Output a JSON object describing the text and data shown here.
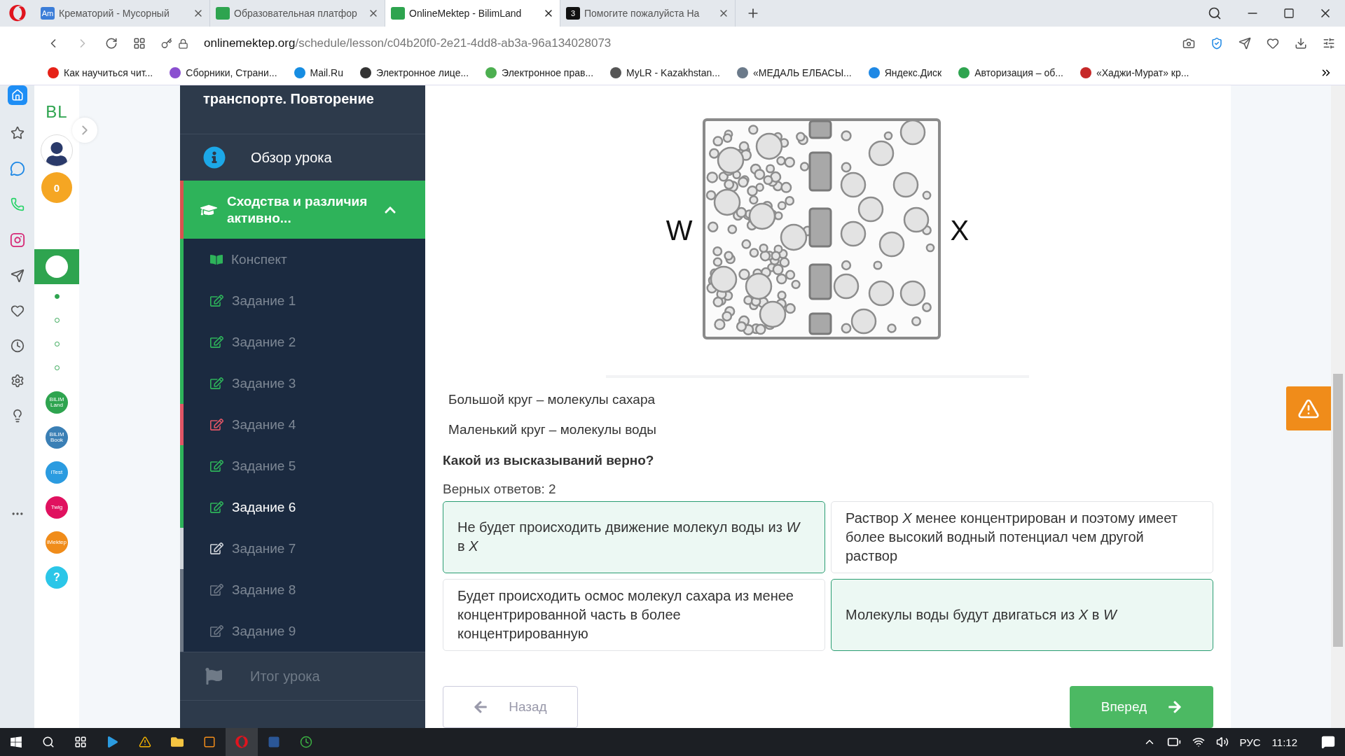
{
  "browser": {
    "tabs": [
      {
        "icon_text": "Am",
        "title": "Крематорий - Мусорный",
        "selected": false
      },
      {
        "title": "Образовательная платфор",
        "selected": false
      },
      {
        "title": "OnlineMektep - BilimLand",
        "selected": true
      },
      {
        "icon_text": "3",
        "title": "Помогите пожалуйста На",
        "selected": false
      }
    ],
    "url_host": "onlinemektep.org",
    "url_path": "/schedule/lesson/c04b20f0-2e21-4dd8-ab3a-96a134028073",
    "bookmarks": [
      {
        "title": "Как научиться чит...",
        "color": "#e62117"
      },
      {
        "title": "Сборники, Страни...",
        "color": "#8a4fd0"
      },
      {
        "title": "Mail.Ru",
        "color": "#168de2"
      },
      {
        "title": "Электронное лице...",
        "color": "#333333"
      },
      {
        "title": "Электронное прав...",
        "color": "#4caf50"
      },
      {
        "title": "MyLR - Kazakhstan...",
        "color": "#555555"
      },
      {
        "title": "«МЕДАЛЬ ЕЛБАСЫ...",
        "color": "#6b7a8a"
      },
      {
        "title": "Яндекс.Диск",
        "color": "#1e88e5"
      },
      {
        "title": "Авторизация – об...",
        "color": "#2ea44f"
      },
      {
        "title": "«Хаджи-Мурат» кр...",
        "color": "#c62828"
      }
    ]
  },
  "app_rail": {
    "logo": "BL",
    "coins": "0",
    "dots": [
      {
        "selected": true
      },
      {
        "selected": false
      },
      {
        "selected": false
      },
      {
        "selected": false
      }
    ],
    "apps": [
      {
        "label": "BILIM Land",
        "color": "#2ea44f"
      },
      {
        "label": "BILIM Book",
        "color": "#3a7fb5"
      },
      {
        "label": "iTest",
        "color": "#2b9be0"
      },
      {
        "label": "Twig",
        "color": "#e0115f"
      },
      {
        "label": "iMektep",
        "color": "#f08c1a"
      },
      {
        "label": "?",
        "color": "#2bc6e8"
      }
    ]
  },
  "lesson_nav": {
    "title": "транспорте. Повторение",
    "overview": "Обзор урока",
    "section": {
      "title": "Сходства и различия активно...",
      "expanded": true
    },
    "items": [
      {
        "kind": "notes",
        "label": "Конспект",
        "color": "#2eb35a",
        "selected": false
      },
      {
        "kind": "task",
        "label": "Задание 1",
        "color": "#2eb35a",
        "selected": false
      },
      {
        "kind": "task",
        "label": "Задание 2",
        "color": "#2eb35a",
        "selected": false
      },
      {
        "kind": "task",
        "label": "Задание 3",
        "color": "#2eb35a",
        "selected": false
      },
      {
        "kind": "task",
        "label": "Задание 4",
        "color": "#e05565",
        "selected": false
      },
      {
        "kind": "task",
        "label": "Задание 5",
        "color": "#2eb35a",
        "selected": false
      },
      {
        "kind": "task",
        "label": "Задание 6",
        "color": "#2eb35a",
        "selected": true
      },
      {
        "kind": "task",
        "label": "Задание 7",
        "color": "#d0d4da",
        "selected": false
      },
      {
        "kind": "task",
        "label": "Задание 8",
        "color": "#6c7684",
        "selected": false
      },
      {
        "kind": "task",
        "label": "Задание 9",
        "color": "#6c7684",
        "selected": false
      }
    ],
    "summary": "Итог урока"
  },
  "question": {
    "diagram": {
      "left_label": "W",
      "right_label": "X"
    },
    "legend": [
      "Большой круг – молекулы сахара",
      "Маленький круг – молекулы воды"
    ],
    "prompt": "Какой из высказываний верно?",
    "answer_count": "Верных ответов: 2",
    "options": [
      {
        "text": "Не будет происходить движение молекул воды из *W* в *X*",
        "selected": true
      },
      {
        "text": "Раствор *X* менее концентрирован и поэтому имеет более высокий водный потенциал чем другой раствор",
        "selected": false
      },
      {
        "text": "Будет происходить осмос молекул сахара из менее концентрированной часть в более концентрированную",
        "selected": false
      },
      {
        "text": "Молекулы воды будут двигаться из *X* в *W*",
        "selected": true
      }
    ],
    "back": "Назад",
    "next": "Вперед"
  },
  "taskbar": {
    "language": "РУС",
    "time": "11:12"
  }
}
